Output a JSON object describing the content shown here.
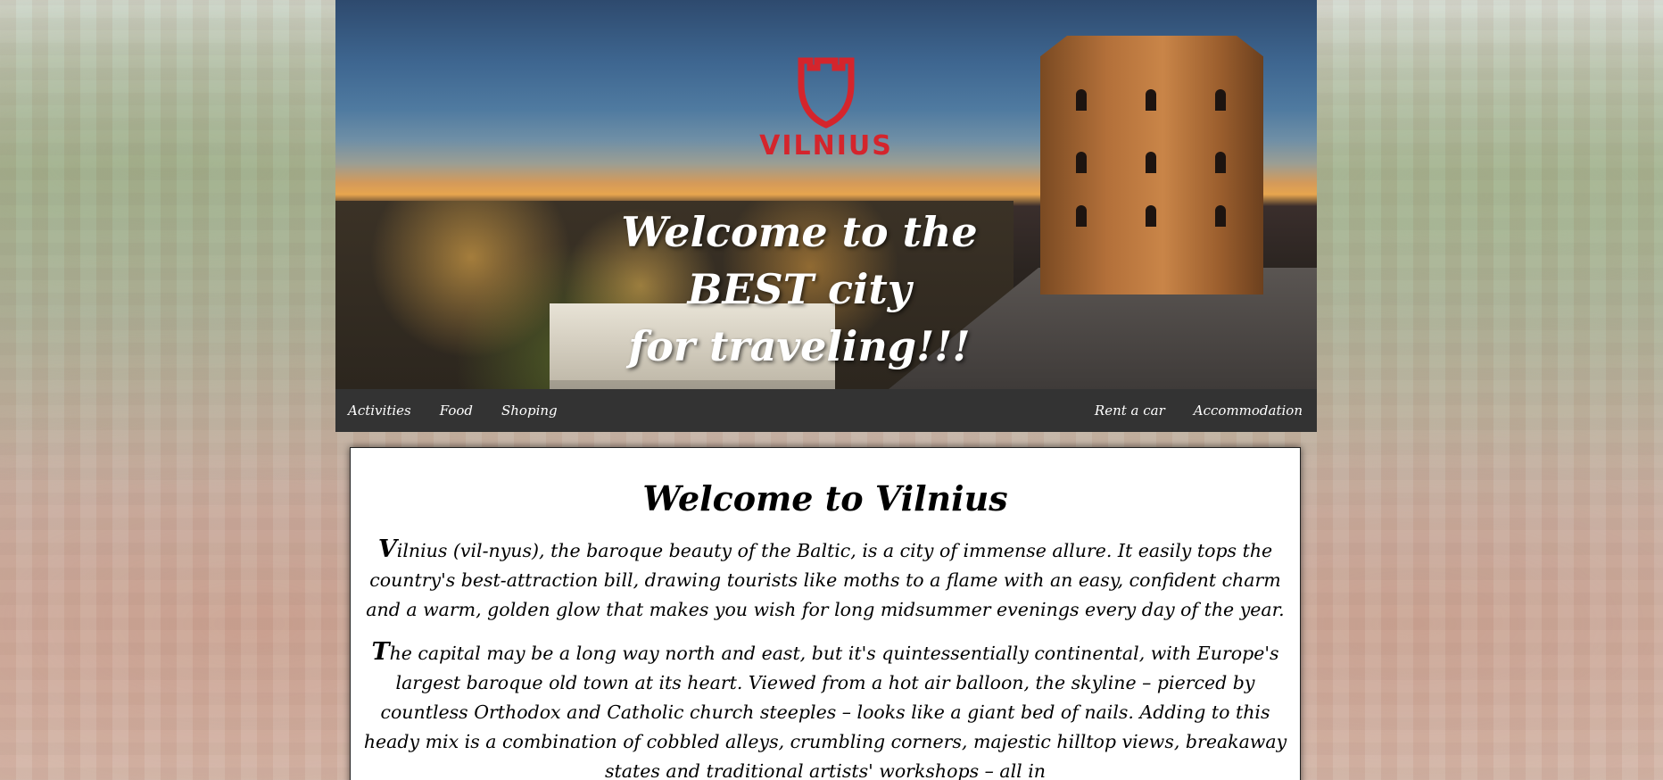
{
  "hero": {
    "logo_text": "VILNIUS",
    "title_line1": "Welcome to the BEST city",
    "title_line2": "for traveling!!!"
  },
  "nav": {
    "left_items": [
      "Activities",
      "Food",
      "Shoping"
    ],
    "right_items": [
      "Rent a car",
      "Accommodation"
    ]
  },
  "content": {
    "heading": "Welcome to Vilnius",
    "paragraphs": [
      {
        "initial": "V",
        "text": "ilnius (vil-nyus), the baroque beauty of the Baltic, is a city of immense allure. It easily tops the country's best-attraction bill, drawing tourists like moths to a flame with an easy, confident charm and a warm, golden glow that makes you wish for long midsummer evenings every day of the year."
      },
      {
        "initial": "T",
        "text": "he capital may be a long way north and east, but it's quintessentially continental, with Europe's largest baroque old town at its heart. Viewed from a hot air balloon, the skyline – pierced by countless Orthodox and Catholic church steeples – looks like a giant bed of nails. Adding to this heady mix is a combination of cobbled alleys, crumbling corners, majestic hilltop views, breakaway states and traditional artists' workshops – all in"
      }
    ]
  },
  "colors": {
    "brand_red": "#d4252c",
    "nav_bg": "#333333"
  },
  "icons": {
    "logo": "castle-tower-icon"
  }
}
